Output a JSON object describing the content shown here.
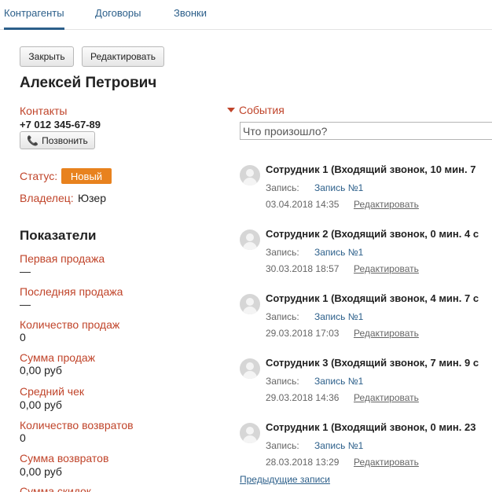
{
  "tabs": [
    "Контрагенты",
    "Договоры",
    "Звонки"
  ],
  "toolbar": {
    "close_label": "Закрыть",
    "edit_label": "Редактировать"
  },
  "contact": {
    "name": "Алексей Петрович",
    "contacts_label": "Контакты",
    "phone": "+7 012 345-67-89",
    "call_label": "Позвонить",
    "status_label": "Статус:",
    "status_value": "Новый",
    "status_color": "#e8821e",
    "owner_label": "Владелец:",
    "owner_value": "Юзер"
  },
  "metrics": {
    "title": "Показатели",
    "items": [
      {
        "label": "Первая продажа",
        "value": "—"
      },
      {
        "label": "Последняя продажа",
        "value": "—"
      },
      {
        "label": "Количество продаж",
        "value": "0"
      },
      {
        "label": "Сумма продаж",
        "value": "0,00 руб"
      },
      {
        "label": "Средний чек",
        "value": "0,00 руб"
      },
      {
        "label": "Количество возвратов",
        "value": "0"
      },
      {
        "label": "Сумма возвратов",
        "value": "0,00 руб"
      },
      {
        "label": "Сумма скидок",
        "value": ""
      }
    ]
  },
  "events": {
    "title": "События",
    "placeholder": "Что произошло?",
    "record_label": "Запись:",
    "edit_label": "Редактировать",
    "items": [
      {
        "title": "Сотрудник 1 (Входящий звонок, 10 мин. 7",
        "record": "Запись №1",
        "date": "03.04.2018 14:35"
      },
      {
        "title": "Сотрудник 2 (Входящий звонок, 0 мин. 4 с",
        "record": "Запись №1",
        "date": "30.03.2018 18:57"
      },
      {
        "title": "Сотрудник 1 (Входящий звонок, 4 мин. 7 с",
        "record": "Запись №1",
        "date": "29.03.2018 17:03"
      },
      {
        "title": "Сотрудник 3 (Входящий звонок, 7 мин. 9 с",
        "record": "Запись №1",
        "date": "29.03.2018 14:36"
      },
      {
        "title": "Сотрудник 1 (Входящий звонок, 0 мин. 23",
        "record": "Запись №1",
        "date": "28.03.2018 13:29"
      }
    ],
    "prev_link": "Предыдущие записи"
  }
}
